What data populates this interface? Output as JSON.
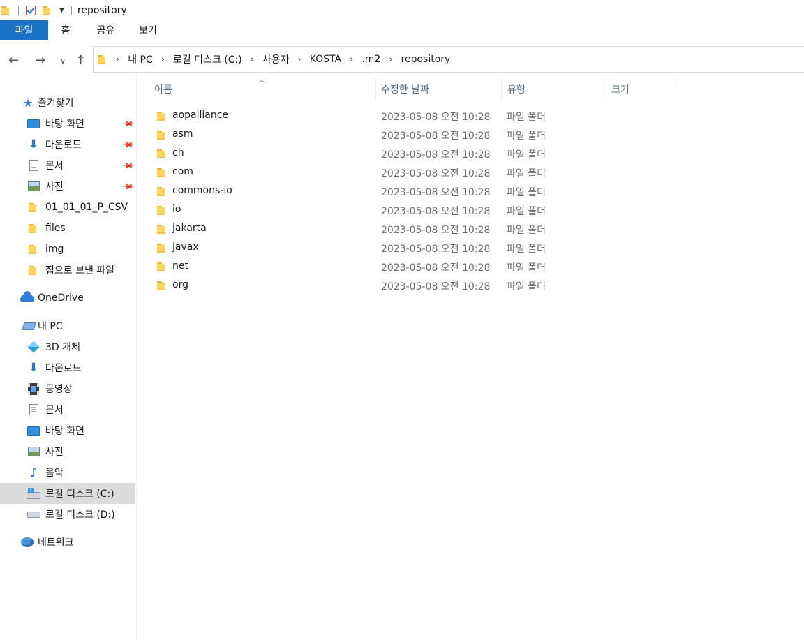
{
  "window": {
    "title": "repository"
  },
  "ribbon": {
    "tabs": [
      "파일",
      "홈",
      "공유",
      "보기"
    ]
  },
  "address": {
    "crumbs": [
      "내 PC",
      "로컬 디스크 (C:)",
      "사용자",
      "KOSTA",
      ".m2",
      "repository"
    ]
  },
  "sidebar": {
    "quick_access": {
      "label": "즐겨찾기",
      "items": [
        {
          "label": "바탕 화면",
          "icon": "desktop-icon",
          "pinned": true
        },
        {
          "label": "다운로드",
          "icon": "download-icon",
          "pinned": true
        },
        {
          "label": "문서",
          "icon": "document-icon",
          "pinned": true
        },
        {
          "label": "사진",
          "icon": "pictures-icon",
          "pinned": true
        },
        {
          "label": "01_01_01_P_CSV",
          "icon": "folder-icon",
          "pinned": false
        },
        {
          "label": "files",
          "icon": "folder-icon",
          "pinned": false
        },
        {
          "label": "img",
          "icon": "folder-icon",
          "pinned": false
        },
        {
          "label": "집으로 보낸 파일",
          "icon": "folder-icon",
          "pinned": false
        }
      ]
    },
    "onedrive": {
      "label": "OneDrive"
    },
    "this_pc": {
      "label": "내 PC",
      "items": [
        {
          "label": "3D 개체",
          "icon": "3d-objects-icon"
        },
        {
          "label": "다운로드",
          "icon": "download-icon"
        },
        {
          "label": "동영상",
          "icon": "video-icon"
        },
        {
          "label": "문서",
          "icon": "document-icon"
        },
        {
          "label": "바탕 화면",
          "icon": "desktop-icon"
        },
        {
          "label": "사진",
          "icon": "pictures-icon"
        },
        {
          "label": "음악",
          "icon": "music-icon"
        },
        {
          "label": "로컬 디스크 (C:)",
          "icon": "local-disk-c-icon",
          "selected": true
        },
        {
          "label": "로컬 디스크 (D:)",
          "icon": "local-disk-d-icon"
        }
      ]
    },
    "network": {
      "label": "네트워크"
    }
  },
  "columns": {
    "name": "이름",
    "modified": "수정한 날짜",
    "type": "유형",
    "size": "크기"
  },
  "files": [
    {
      "name": "aopalliance",
      "modified": "2023-05-08 오전 10:28",
      "type": "파일 폴더"
    },
    {
      "name": "asm",
      "modified": "2023-05-08 오전 10:28",
      "type": "파일 폴더"
    },
    {
      "name": "ch",
      "modified": "2023-05-08 오전 10:28",
      "type": "파일 폴더"
    },
    {
      "name": "com",
      "modified": "2023-05-08 오전 10:28",
      "type": "파일 폴더"
    },
    {
      "name": "commons-io",
      "modified": "2023-05-08 오전 10:28",
      "type": "파일 폴더"
    },
    {
      "name": "io",
      "modified": "2023-05-08 오전 10:28",
      "type": "파일 폴더"
    },
    {
      "name": "jakarta",
      "modified": "2023-05-08 오전 10:28",
      "type": "파일 폴더"
    },
    {
      "name": "javax",
      "modified": "2023-05-08 오전 10:28",
      "type": "파일 폴더"
    },
    {
      "name": "net",
      "modified": "2023-05-08 오전 10:28",
      "type": "파일 폴더"
    },
    {
      "name": "org",
      "modified": "2023-05-08 오전 10:28",
      "type": "파일 폴더"
    }
  ]
}
